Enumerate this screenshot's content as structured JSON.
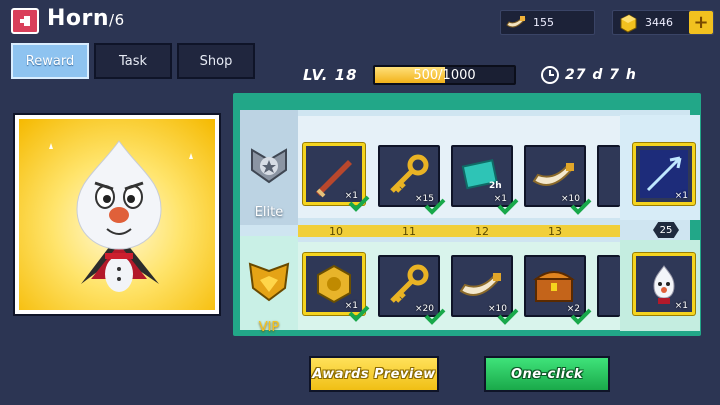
{
  "header": {
    "title": "Horn",
    "title_count": "/6",
    "currency_1": "155",
    "currency_2": "3446",
    "plus_label": "+"
  },
  "tabs": [
    {
      "label": "Reward",
      "active": true
    },
    {
      "label": "Task",
      "active": false
    },
    {
      "label": "Shop",
      "active": false
    }
  ],
  "level": {
    "label": "LV. 18",
    "progress_text": "500/1000",
    "progress": 0.5,
    "timer": "27 d 7 h"
  },
  "tracks": {
    "elite_label": "Elite",
    "vip_label": "VIP",
    "levels": [
      "10",
      "11",
      "12",
      "13"
    ],
    "side_level": "25",
    "elite_items": [
      {
        "icon": "sword-icon",
        "qty": "×1"
      },
      {
        "icon": "key-icon",
        "qty": "×15"
      },
      {
        "icon": "exp-card-icon",
        "qty": "×1",
        "tag": "2h"
      },
      {
        "icon": "horn-icon",
        "qty": "×10"
      }
    ],
    "vip_items": [
      {
        "icon": "emblem-icon",
        "qty": "×1"
      },
      {
        "icon": "key-icon",
        "qty": "×20"
      },
      {
        "icon": "horn-icon",
        "qty": "×10"
      },
      {
        "icon": "chest-icon",
        "qty": "×2"
      }
    ],
    "side_elite": {
      "icon": "arrow-skill-icon",
      "qty": "×1"
    },
    "side_vip": {
      "icon": "snowman-icon",
      "qty": "×1"
    }
  },
  "buttons": {
    "preview": "Awards Preview",
    "one_click": "One-click"
  },
  "colors": {
    "background": "#2c3553",
    "accent_gold": "#f5d41e",
    "accent_green": "#22a788",
    "tab_active": "#8ec3f0"
  }
}
